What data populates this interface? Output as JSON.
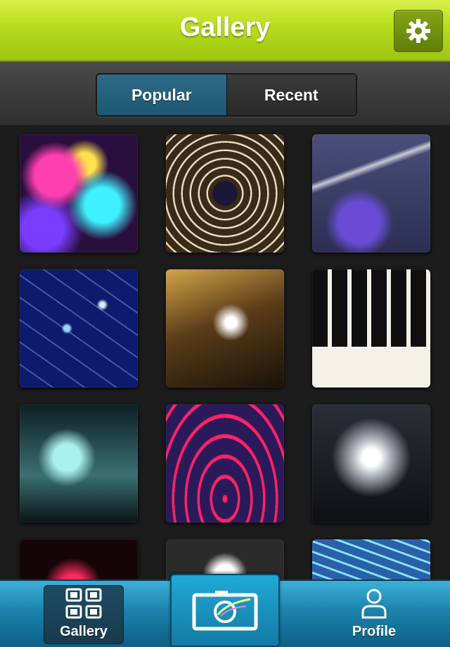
{
  "header": {
    "title": "Gallery",
    "settings_icon": "gear-icon",
    "accent": "#b8dc1c"
  },
  "segments": {
    "active": "Popular",
    "inactive": "Recent",
    "selected_color": "#2e6c8a"
  },
  "grid": {
    "thumbnails": [
      {
        "alt": ""
      },
      {
        "alt": ""
      },
      {
        "alt": ""
      },
      {
        "alt": ""
      },
      {
        "alt": ""
      },
      {
        "alt": ""
      },
      {
        "alt": ""
      },
      {
        "alt": ""
      },
      {
        "alt": ""
      },
      {
        "alt": ""
      },
      {
        "alt": ""
      },
      {
        "alt": ""
      }
    ]
  },
  "tabbar": {
    "gallery_label": "Gallery",
    "gallery_icon": "grid-icon",
    "camera_icon": "camera-icon",
    "profile_label": "Profile",
    "profile_icon": "person-icon",
    "bar_color": "#1a83ad"
  }
}
